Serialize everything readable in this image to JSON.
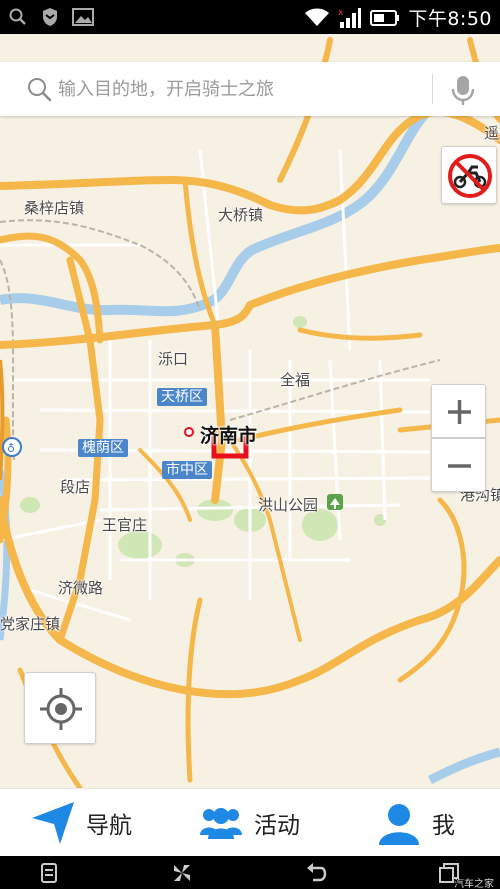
{
  "status_bar": {
    "time": "下午8:50",
    "icons": [
      "search-icon",
      "shield-icon",
      "image-icon",
      "wifi-icon",
      "signal-icon",
      "battery-icon"
    ]
  },
  "search": {
    "placeholder": "输入目的地，开启骑士之旅",
    "value": "",
    "icon": "search-icon",
    "voice_icon": "microphone-icon"
  },
  "map": {
    "labels": {
      "sangzi": "桑梓店镇",
      "daqiao": "大桥镇",
      "luokou": "泺口",
      "tianqiao": "天桥区",
      "jinan": "济南市",
      "huaiyin": "槐荫区",
      "shizhong": "市中区",
      "duandian": "段店",
      "wangguanzhuang": "王官庄",
      "jiwei": "济微路",
      "jiazhuang": "党家庄镇",
      "quanfu": "全福",
      "hongshan": "洪山公园",
      "gangou": "港沟镇",
      "yao": "遥"
    },
    "colors": {
      "land": "#f7f1e3",
      "major_road": "#f5b64a",
      "minor_road": "#ffffff",
      "river": "#a8cdea",
      "green": "#cfe6b5",
      "district_badge": "#4a86c9",
      "route_marker": "#e8101c"
    },
    "controls": {
      "no_motorcycle": "no-motorcycle-icon",
      "zoom_in": "+",
      "zoom_out": "−",
      "locate": "locate-icon"
    }
  },
  "tabs": [
    {
      "label": "导航",
      "icon": "navigation-arrow-icon"
    },
    {
      "label": "活动",
      "icon": "people-icon"
    },
    {
      "label": "我",
      "icon": "user-icon"
    }
  ],
  "android_nav": {
    "icons": [
      "menu-icon",
      "home-icon",
      "back-icon",
      "recent-apps-icon"
    ],
    "watermark": "汽车之家"
  }
}
